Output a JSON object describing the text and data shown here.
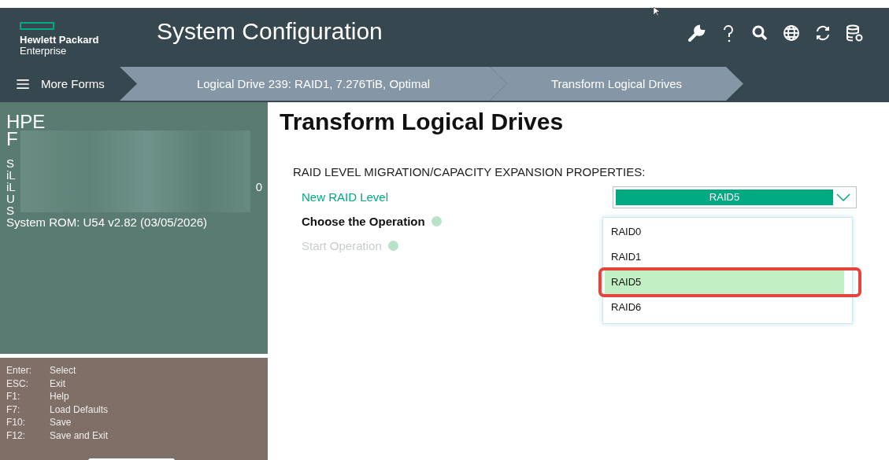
{
  "header": {
    "logo_line1": "Hewlett Packard",
    "logo_line2": "Enterprise",
    "title": "System Configuration"
  },
  "breadcrumb": {
    "menu": "More Forms",
    "items": [
      "Logical Drive 239: RAID1, 7.276TiB, Optimal",
      "Transform Logical Drives"
    ]
  },
  "sidebar": {
    "heading_lines": [
      "HPE",
      "F"
    ],
    "info_lines": [
      {
        "start": "S"
      },
      {
        "start": "iL"
      },
      {
        "start": "iL",
        "end": "0"
      },
      {
        "start": "U"
      },
      {
        "start": "S"
      }
    ],
    "rom": "System ROM: U54 v2.82 (03/05/2026)",
    "keys": [
      {
        "key": "Enter:",
        "action": "Select"
      },
      {
        "key": "ESC:",
        "action": "Exit"
      },
      {
        "key": "F1:",
        "action": "Help"
      },
      {
        "key": "F7:",
        "action": "Load Defaults"
      },
      {
        "key": "F10:",
        "action": "Save"
      },
      {
        "key": "F12:",
        "action": "Save and Exit"
      }
    ]
  },
  "main": {
    "title": "Transform Logical Drives",
    "section": "RAID LEVEL MIGRATION/CAPACITY EXPANSION PROPERTIES:",
    "fields": [
      {
        "kind": "dropdown",
        "label": "New RAID Level",
        "focused": true,
        "value": "RAID5",
        "expanded": true,
        "options": [
          {
            "label": "RAID0",
            "selected": false,
            "annotated": false
          },
          {
            "label": "RAID1",
            "selected": false,
            "annotated": false
          },
          {
            "label": "RAID5",
            "selected": true,
            "annotated": true
          },
          {
            "label": "RAID6",
            "selected": false,
            "annotated": false
          }
        ]
      },
      {
        "kind": "action",
        "label": "Choose the Operation",
        "focused": false,
        "disabled": false
      },
      {
        "kind": "action",
        "label": "Start Operation",
        "focused": false,
        "disabled": true
      }
    ]
  }
}
